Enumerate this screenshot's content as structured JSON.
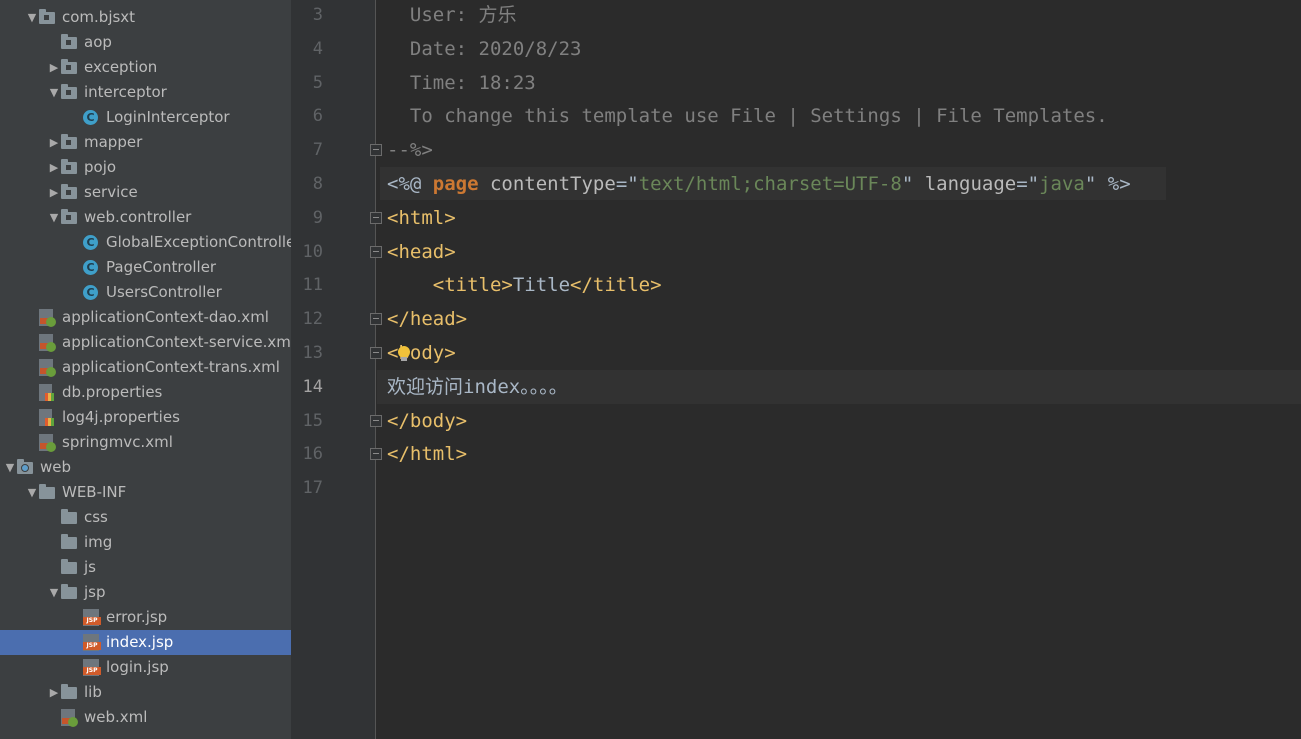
{
  "tree": [
    {
      "label": "com.bjsxt",
      "icon": "package-folder-icon",
      "arrow": "▼",
      "depth": 1
    },
    {
      "label": "aop",
      "icon": "package-folder-icon",
      "arrow": "",
      "depth": 2
    },
    {
      "label": "exception",
      "icon": "package-folder-icon",
      "arrow": "▶",
      "depth": 2
    },
    {
      "label": "interceptor",
      "icon": "package-folder-icon",
      "arrow": "▼",
      "depth": 2
    },
    {
      "label": "LoginInterceptor",
      "icon": "java-class-icon",
      "arrow": "",
      "depth": 3
    },
    {
      "label": "mapper",
      "icon": "package-folder-icon",
      "arrow": "▶",
      "depth": 2
    },
    {
      "label": "pojo",
      "icon": "package-folder-icon",
      "arrow": "▶",
      "depth": 2
    },
    {
      "label": "service",
      "icon": "package-folder-icon",
      "arrow": "▶",
      "depth": 2
    },
    {
      "label": "web.controller",
      "icon": "package-folder-icon",
      "arrow": "▼",
      "depth": 2
    },
    {
      "label": "GlobalExceptionControlle",
      "icon": "java-class-icon",
      "arrow": "",
      "depth": 3
    },
    {
      "label": "PageController",
      "icon": "java-class-icon",
      "arrow": "",
      "depth": 3
    },
    {
      "label": "UsersController",
      "icon": "java-class-icon",
      "arrow": "",
      "depth": 3
    },
    {
      "label": "applicationContext-dao.xml",
      "icon": "spring-xml-icon",
      "arrow": "",
      "depth": 1
    },
    {
      "label": "applicationContext-service.xml",
      "icon": "spring-xml-icon",
      "arrow": "",
      "depth": 1
    },
    {
      "label": "applicationContext-trans.xml",
      "icon": "spring-xml-icon",
      "arrow": "",
      "depth": 1
    },
    {
      "label": "db.properties",
      "icon": "properties-file-icon",
      "arrow": "",
      "depth": 1
    },
    {
      "label": "log4j.properties",
      "icon": "properties-file-icon",
      "arrow": "",
      "depth": 1
    },
    {
      "label": "springmvc.xml",
      "icon": "spring-xml-icon",
      "arrow": "",
      "depth": 1
    },
    {
      "label": "web",
      "icon": "web-folder-icon",
      "arrow": "▼",
      "depth": 0
    },
    {
      "label": "WEB-INF",
      "icon": "folder-icon",
      "arrow": "▼",
      "depth": 1
    },
    {
      "label": "css",
      "icon": "folder-icon",
      "arrow": "",
      "depth": 2
    },
    {
      "label": "img",
      "icon": "folder-icon",
      "arrow": "",
      "depth": 2
    },
    {
      "label": "js",
      "icon": "folder-icon",
      "arrow": "",
      "depth": 2
    },
    {
      "label": "jsp",
      "icon": "folder-icon",
      "arrow": "▼",
      "depth": 2
    },
    {
      "label": "error.jsp",
      "icon": "jsp-file-icon",
      "arrow": "",
      "depth": 3
    },
    {
      "label": "index.jsp",
      "icon": "jsp-file-icon",
      "arrow": "",
      "depth": 3,
      "selected": true
    },
    {
      "label": "login.jsp",
      "icon": "jsp-file-icon",
      "arrow": "",
      "depth": 3
    },
    {
      "label": "lib",
      "icon": "folder-icon",
      "arrow": "▶",
      "depth": 2
    },
    {
      "label": "web.xml",
      "icon": "web-xml-icon",
      "arrow": "",
      "depth": 2
    }
  ],
  "editor": {
    "current_line": 14,
    "lines": [
      {
        "n": "3",
        "tokens": [
          {
            "t": "  User: 方乐",
            "c": "cmt"
          }
        ]
      },
      {
        "n": "4",
        "tokens": [
          {
            "t": "  Date: 2020/8/23",
            "c": "cmt"
          }
        ]
      },
      {
        "n": "5",
        "tokens": [
          {
            "t": "  Time: 18:23",
            "c": "cmt"
          }
        ]
      },
      {
        "n": "6",
        "tokens": [
          {
            "t": "  To change this template use File | Settings | File Templates.",
            "c": "cmt"
          }
        ]
      },
      {
        "n": "7",
        "fold": true,
        "tokens": [
          {
            "t": "--%>",
            "c": "cmt"
          }
        ]
      },
      {
        "n": "8",
        "tokens": [
          {
            "t": "<%@ ",
            "c": "txt"
          },
          {
            "t": "page",
            "c": "dir"
          },
          {
            "t": " contentType",
            "c": "attr"
          },
          {
            "t": "=\"",
            "c": "txt"
          },
          {
            "t": "text/html;charset=UTF-8",
            "c": "str"
          },
          {
            "t": "\"",
            "c": "txt"
          },
          {
            "t": " language",
            "c": "attr"
          },
          {
            "t": "=\"",
            "c": "txt"
          },
          {
            "t": "java",
            "c": "str"
          },
          {
            "t": "\" %>",
            "c": "txt"
          }
        ]
      },
      {
        "n": "9",
        "fold": true,
        "tokens": [
          {
            "t": "<html>",
            "c": "tag"
          }
        ]
      },
      {
        "n": "10",
        "fold": true,
        "tokens": [
          {
            "t": "<head>",
            "c": "tag"
          }
        ]
      },
      {
        "n": "11",
        "tokens": [
          {
            "t": "    ",
            "c": "txt"
          },
          {
            "t": "<title>",
            "c": "tag"
          },
          {
            "t": "Title",
            "c": "txt"
          },
          {
            "t": "</title>",
            "c": "tag"
          }
        ]
      },
      {
        "n": "12",
        "fold": true,
        "tokens": [
          {
            "t": "</head>",
            "c": "tag"
          }
        ]
      },
      {
        "n": "13",
        "fold": true,
        "tokens": [
          {
            "t": "<body>",
            "c": "tag"
          }
        ]
      },
      {
        "n": "14",
        "tokens": [
          {
            "t": "欢迎访问index。。。。",
            "c": "txt"
          }
        ]
      },
      {
        "n": "15",
        "fold": true,
        "tokens": [
          {
            "t": "</body>",
            "c": "tag"
          }
        ]
      },
      {
        "n": "16",
        "fold": true,
        "tokens": [
          {
            "t": "</html>",
            "c": "tag"
          }
        ]
      },
      {
        "n": "17",
        "tokens": []
      }
    ]
  },
  "colors": {
    "tree_bg": "#3c3f41",
    "editor_bg": "#2b2b2b",
    "gutter_bg": "#313335",
    "selection": "#4b6eaf",
    "comment": "#808080",
    "tag": "#e8bf6a",
    "string": "#6a8759",
    "keyword": "#cc7832",
    "text": "#a9b7c6"
  }
}
